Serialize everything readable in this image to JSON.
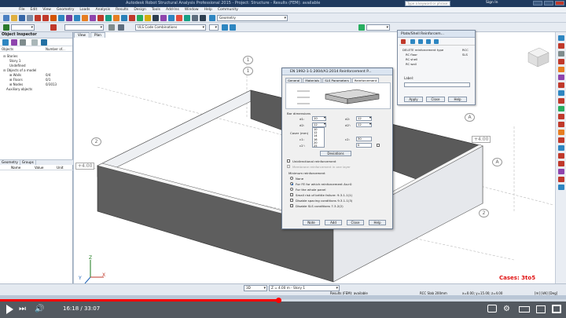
{
  "window": {
    "title": "Autodesk Robot Structural Analysis Professional 2015 - Project: Structure - Results (FEM): available",
    "search_placeholder": "Type a keyword or phrase",
    "sign_in": "Sign In"
  },
  "menu": [
    "File",
    "Edit",
    "View",
    "Geometry",
    "Loads",
    "Analysis",
    "Results",
    "Design",
    "Tools",
    "Add-Ins",
    "Window",
    "Help",
    "Community"
  ],
  "toolbar": {
    "layout_combo": "Geometry",
    "case_combo": "ULS Code Combinations"
  },
  "object_inspector": {
    "title": "Object Inspector",
    "col_objects": "Objects",
    "col_number": "Number of...",
    "tree": [
      {
        "label": "Stories",
        "value": ""
      },
      {
        "label": "Story 1",
        "value": ""
      },
      {
        "label": "Undefined",
        "value": ""
      },
      {
        "label": "Objects of a model",
        "value": ""
      },
      {
        "label": "Walls",
        "value": "0/4"
      },
      {
        "label": "Floors",
        "value": "0/1"
      },
      {
        "label": "Nodes",
        "value": "0/3013"
      },
      {
        "label": "Auxiliary objects",
        "value": ""
      }
    ],
    "bottom_tabs": [
      "Geometry",
      "Groups"
    ],
    "prop_cols": [
      "Name",
      "Value",
      "Unit"
    ]
  },
  "view_tabs": [
    "View",
    "Plan"
  ],
  "viewport": {
    "grid_labels": [
      "1",
      "1",
      "2",
      "A",
      "A",
      "2"
    ],
    "level_labels": [
      "+4.00",
      "+4.00"
    ],
    "axis_x": "X",
    "axis_y": "Y",
    "axis_z": "Z",
    "cases": "Cases: 3to5"
  },
  "dialog": {
    "title": "EN 1992-1-1:2004/A1:2014 Reinforcement P...",
    "tabs": [
      "General",
      "Materials",
      "SLS Parameters",
      "Reinforcement"
    ],
    "bar_dimensions_label": "Bar dimensions",
    "d1_label": "d1:",
    "d1_value": "10",
    "d1b_label": "d2:",
    "d1b_value": "12",
    "d2_label": "d2:",
    "d2_value": "12",
    "d2b_label": "d2':",
    "d2b_value": "12",
    "dropdown_options": [
      "10",
      "12",
      "14",
      "16",
      "20",
      "25"
    ],
    "cover_label": "Cover (mm)",
    "c1_label": "c1:",
    "c1_value": "30",
    "c1b_label": "c2:",
    "c1b_value": "30",
    "c2_label": "c2':",
    "c2_value": "0",
    "deviations_button": "Deviations",
    "unidirectional": "Unidirectional reinforcement",
    "nonlinear": "Membrane reinforcement in one layer",
    "minimum_label": "Minimum reinforcement",
    "opt_none": "None",
    "opt_for_fe": "For FE for which reinforcement As>0",
    "opt_whole": "For the whole panel",
    "opt_brittle": "Small risk of brittle failure: 9.3.1.1(1)",
    "opt_spacing": "Disable spacing conditions 9.3.1.1(3)",
    "opt_sls": "Disable SLS conditions 7.3.2(2)",
    "buttons": [
      "Note",
      "Add",
      "Close",
      "Help"
    ]
  },
  "plate_panel": {
    "title": "Plate/Shell Reinforcem...",
    "items": [
      "DELETE reinforcement type",
      "RC floor",
      "RC shell",
      "RC wall"
    ],
    "right_items": [
      "RCC",
      "SLS"
    ],
    "label": "Label:",
    "buttons": [
      "Apply",
      "Close",
      "Help"
    ]
  },
  "status": {
    "view_mode": "3D",
    "story": "Z = 4.00 m - Story 1",
    "results": "Results (FEM): available",
    "code": "RCC Slab 200mm",
    "coords": "x=0.00; y=15.00; z=4.00",
    "units": "[m] [kN] [Deg]"
  },
  "video": {
    "time": "16:18 / 33:07",
    "progress": 0.492
  }
}
